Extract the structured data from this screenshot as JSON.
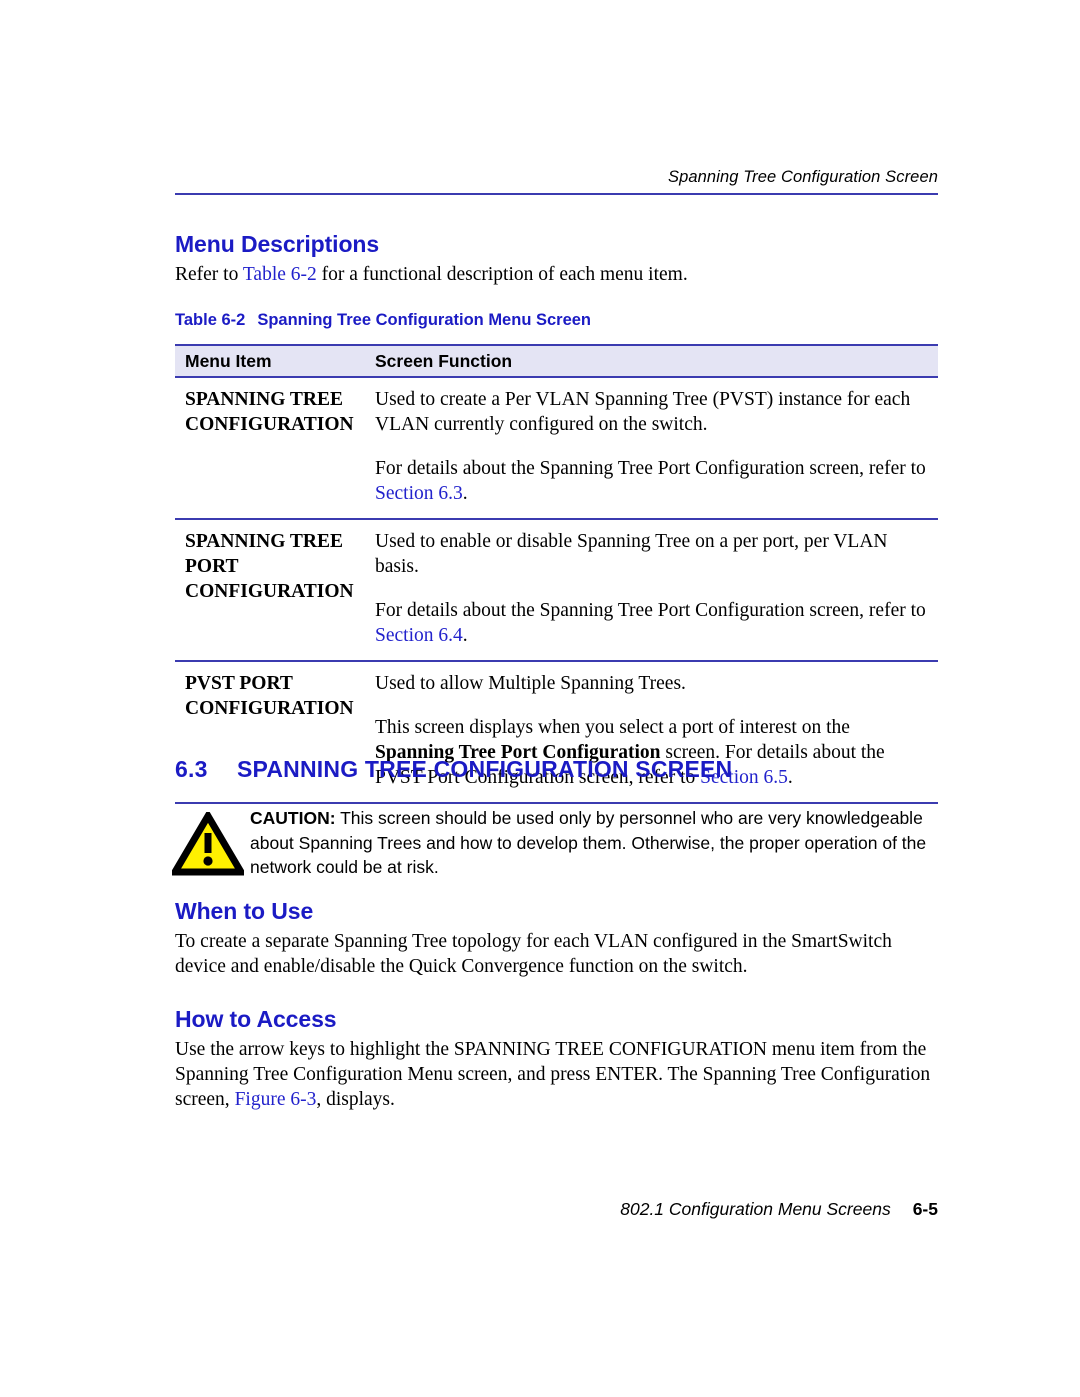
{
  "header": {
    "running_title": "Spanning Tree Configuration Screen"
  },
  "menu_descriptions": {
    "heading": "Menu Descriptions",
    "intro_prefix": "Refer to ",
    "intro_link": "Table 6-2",
    "intro_suffix": " for a functional description of each menu item."
  },
  "table": {
    "caption_number": "Table 6-2",
    "caption_title": "Spanning Tree Configuration Menu Screen",
    "columns": [
      "Menu Item",
      "Screen Function"
    ],
    "rows": [
      {
        "item": "SPANNING TREE CONFIGURATION",
        "para1": "Used to create a Per VLAN Spanning Tree (PVST) instance for each VLAN currently configured on the switch.",
        "para2_prefix": "For details about the Spanning Tree Port Configuration screen, refer to ",
        "para2_link": "Section 6.3",
        "para2_suffix": "."
      },
      {
        "item": "SPANNING TREE PORT CONFIGURATION",
        "para1": "Used to enable or disable Spanning Tree on a per port, per VLAN basis.",
        "para2_prefix": "For details about the Spanning Tree Port Configuration screen, refer to ",
        "para2_link": "Section 6.4",
        "para2_suffix": "."
      },
      {
        "item": "PVST PORT CONFIGURATION",
        "para1": "Used to allow Multiple Spanning Trees.",
        "para2_prefix": "This screen displays when you select a port of interest on the ",
        "para2_bold": "Spanning Tree Port Configuration",
        "para2_mid": " screen. For details about the PVST Port Configuration screen, refer to ",
        "para2_link": "Section 6.5",
        "para2_suffix": "."
      }
    ]
  },
  "section": {
    "number": "6.3",
    "title": "SPANNING TREE CONFIGURATION SCREEN"
  },
  "caution": {
    "label": "CAUTION:",
    "text": " This screen should be used only by personnel who are very knowledgeable about Spanning Trees and how to develop them. Otherwise, the proper operation of the network could be at risk.",
    "icon_fill": "#FFF000",
    "icon_stroke": "#000000"
  },
  "when_to_use": {
    "heading": "When to Use",
    "text": "To create a separate Spanning Tree topology for each VLAN configured in the SmartSwitch device and enable/disable the Quick Convergence function on the switch."
  },
  "how_to_access": {
    "heading": "How to Access",
    "prefix": "Use the arrow keys to highlight the SPANNING TREE CONFIGURATION menu item from the Spanning Tree Configuration Menu screen, and press ENTER. The Spanning Tree Configuration screen, ",
    "link": "Figure 6-3",
    "suffix": ", displays."
  },
  "footer": {
    "text": "802.1 Configuration Menu Screens",
    "page": "6-5"
  },
  "colors": {
    "heading_blue": "#1b1bc4",
    "rule_blue": "#3b3bb0",
    "table_header_bg": "#e4e4f4",
    "link_blue": "#2222cc"
  }
}
